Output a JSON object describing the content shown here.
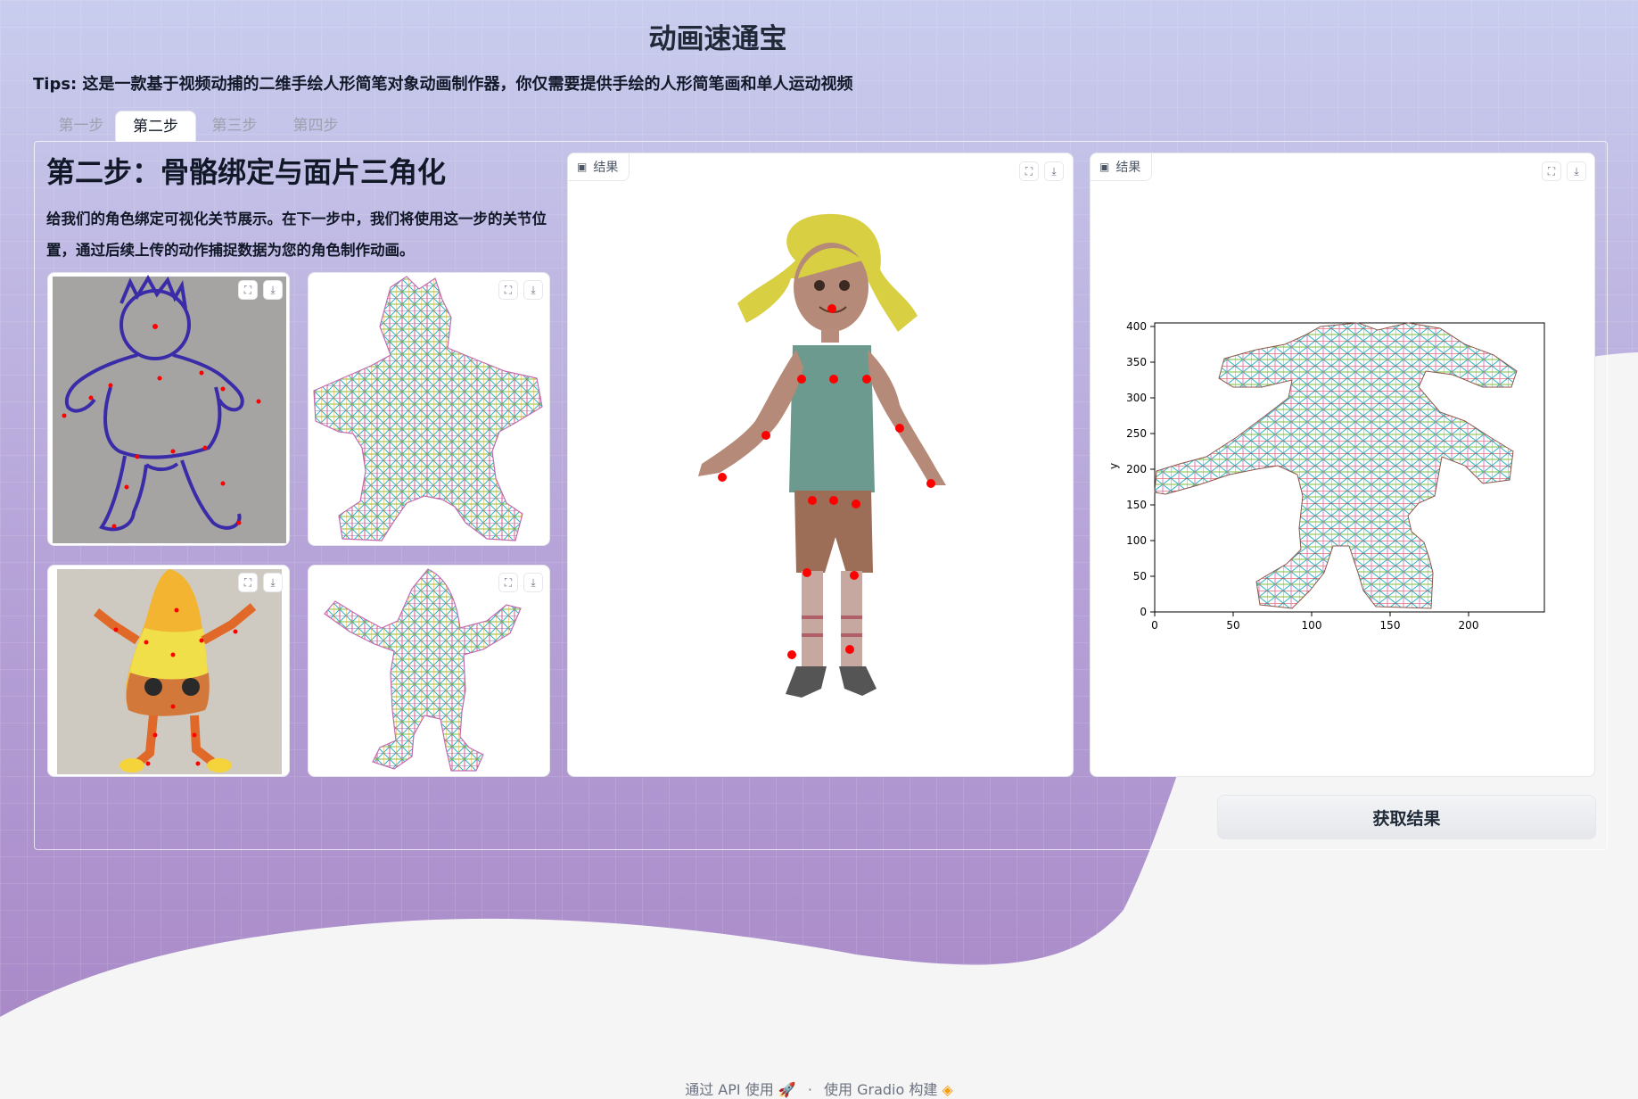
{
  "app": {
    "title": "动画速通宝",
    "tips": "Tips: 这是一款基于视频动捕的二维手绘人形简笔对象动画制作器，你仅需要提供手绘的人形简笔画和单人运动视频"
  },
  "tabs": [
    {
      "label": "第一步",
      "active": false
    },
    {
      "label": "第二步",
      "active": true
    },
    {
      "label": "第三步",
      "active": false
    },
    {
      "label": "第四步",
      "active": false
    }
  ],
  "step": {
    "heading": "第二步：骨骼绑定与面片三角化",
    "description": "给我们的角色绑定可视化关节展示。在下一步中，我们将使用这一步的关节位置，通过后续上传的动作捕捉数据为您的角色制作动画。"
  },
  "result_panels": [
    {
      "label": "结果"
    },
    {
      "label": "结果"
    }
  ],
  "mesh_plot": {
    "ylabel": "y",
    "x_ticks": [
      "0",
      "50",
      "100",
      "150",
      "200"
    ],
    "y_ticks": [
      "0",
      "50",
      "100",
      "150",
      "200",
      "250",
      "300",
      "350",
      "400"
    ]
  },
  "buttons": {
    "get_result": "获取结果"
  },
  "footer": {
    "api": "通过 API 使用",
    "separator": "·",
    "built": "使用 Gradio 构建"
  },
  "icons": {
    "fullscreen": "fullscreen-icon",
    "download": "download-icon",
    "image": "image-icon",
    "rocket": "rocket-icon",
    "gradio_logo": "gradio-logo-icon"
  },
  "colors": {
    "background_top": "#c9cdee",
    "background_bottom": "#a98ac8",
    "page_base": "#f5f5f6",
    "joint": "#ff0000"
  }
}
